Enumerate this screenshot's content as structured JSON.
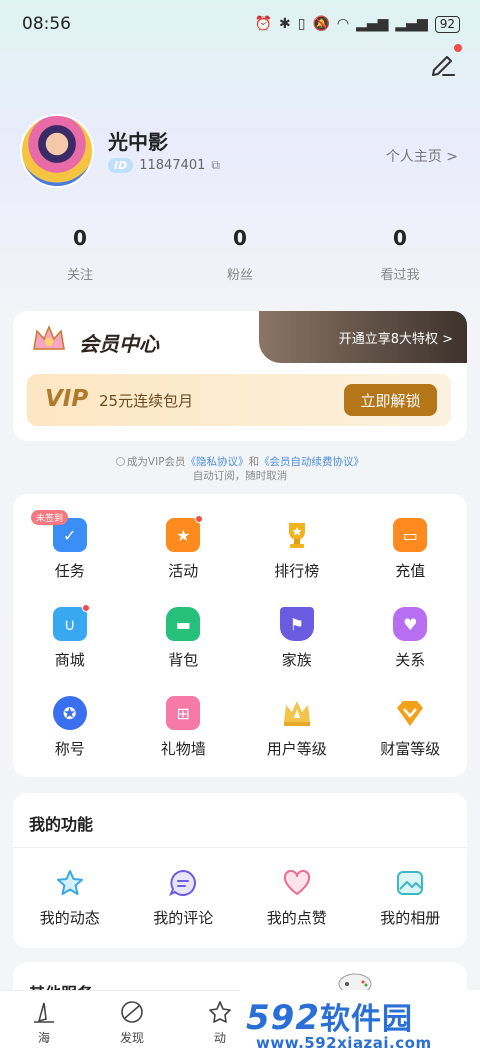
{
  "status_bar": {
    "time": "08:56",
    "icons": [
      "alarm-icon",
      "bluetooth-icon",
      "vibrate-icon",
      "mute-icon",
      "wifi-icon",
      "signal-4g-icon",
      "signal-4g-icon"
    ],
    "battery": "92"
  },
  "header": {
    "edit_icon": "edit-icon",
    "edit_has_dot": true
  },
  "profile": {
    "name": "光中影",
    "id_badge": "ID",
    "id": "11847401",
    "homepage_link": "个人主页 >"
  },
  "stats": [
    {
      "value": "0",
      "label": "关注"
    },
    {
      "value": "0",
      "label": "粉丝"
    },
    {
      "value": "0",
      "label": "看过我"
    }
  ],
  "vip": {
    "title": "会员中心",
    "cta": "开通立享8大特权 >",
    "logo": "VIP",
    "price_text": "25元连续包月",
    "unlock_button": "立即解锁"
  },
  "agreement": {
    "prefix": "成为VIP会员",
    "privacy_link": "《隐私协议》",
    "and": "和",
    "renew_link": "《会员自动续费协议》",
    "line2": "自动订阅，随时取消"
  },
  "grid": {
    "items": [
      {
        "label": "任务",
        "icon": "task-icon",
        "badge": "未签到",
        "color": "#3a8ef6"
      },
      {
        "label": "活动",
        "icon": "activity-icon",
        "dot": true,
        "color": "#ff8a1f"
      },
      {
        "label": "排行榜",
        "icon": "trophy-icon",
        "color": "#f2b21c"
      },
      {
        "label": "充值",
        "icon": "wallet-icon",
        "color": "#ff8a1f"
      },
      {
        "label": "商城",
        "icon": "shop-bag-icon",
        "dot": true,
        "color": "#38a8f2"
      },
      {
        "label": "背包",
        "icon": "backpack-icon",
        "color": "#27c07b"
      },
      {
        "label": "家族",
        "icon": "family-flag-icon",
        "color": "#6a5ce0"
      },
      {
        "label": "关系",
        "icon": "heart-icon",
        "color": "#b86ef0"
      },
      {
        "label": "称号",
        "icon": "medal-icon",
        "color": "#3a6ff0"
      },
      {
        "label": "礼物墙",
        "icon": "gift-icon",
        "color": "#f57aa6"
      },
      {
        "label": "用户等级",
        "icon": "crown-level-icon",
        "color": "#f2c54a"
      },
      {
        "label": "财富等级",
        "icon": "diamond-icon",
        "color": "#f2a11c"
      }
    ]
  },
  "my_functions": {
    "title": "我的功能",
    "items": [
      {
        "label": "我的动态",
        "icon": "star-icon",
        "color": "#3aa8e6"
      },
      {
        "label": "我的评论",
        "icon": "comment-icon",
        "color": "#6a5ce0"
      },
      {
        "label": "我的点赞",
        "icon": "like-heart-icon",
        "color": "#f06a8e"
      },
      {
        "label": "我的相册",
        "icon": "album-icon",
        "color": "#3ab8c6"
      }
    ]
  },
  "other_services": {
    "title": "其他服务"
  },
  "tabbar": {
    "tabs": [
      {
        "label": "海",
        "icon": "sea-icon"
      },
      {
        "label": "发现",
        "icon": "discover-icon"
      },
      {
        "label": "动",
        "icon": "dynamic-icon"
      }
    ]
  },
  "watermark": {
    "brand_num": "592",
    "brand_cn": "软件园",
    "url": "www.592xiazai.com"
  }
}
